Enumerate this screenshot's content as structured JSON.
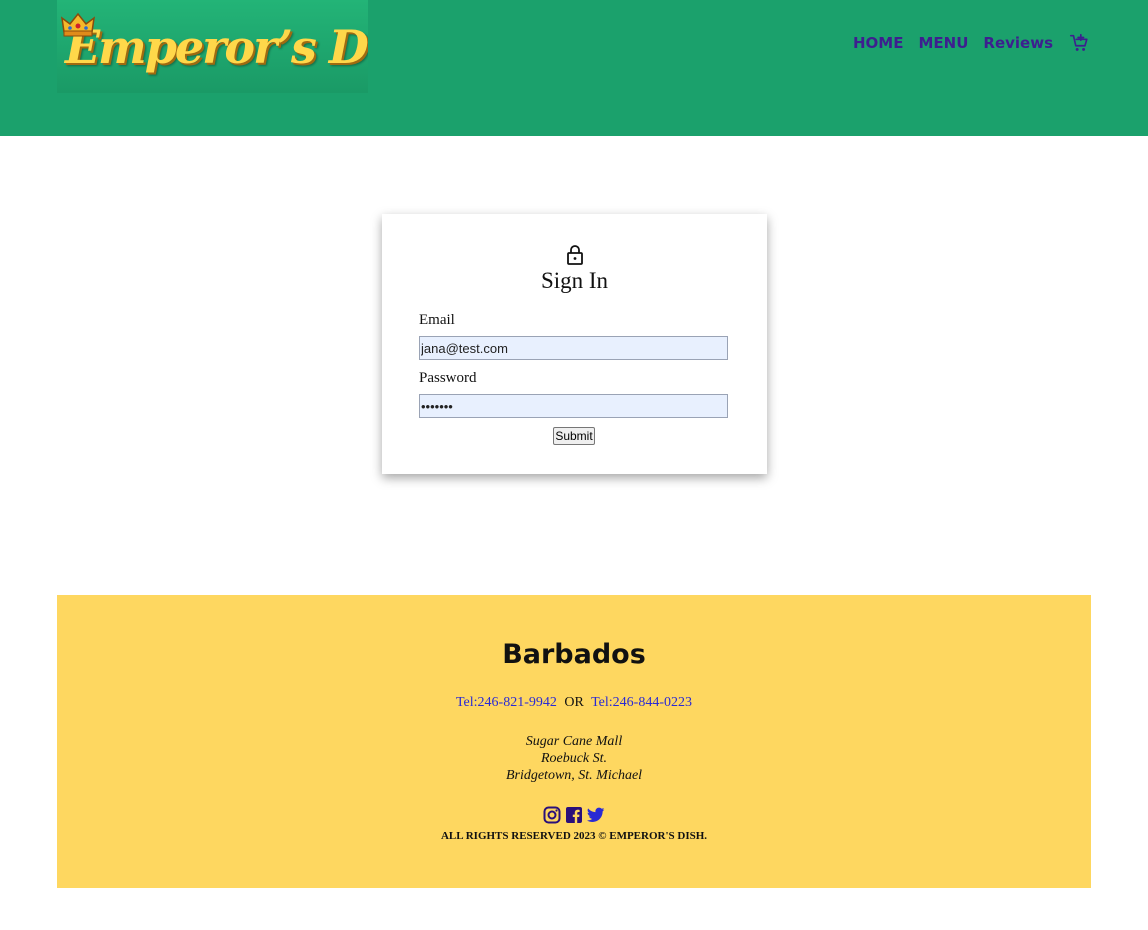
{
  "brand": {
    "logo_text": "Emperor’s Dish"
  },
  "nav": {
    "items": [
      {
        "label": "HOME"
      },
      {
        "label": "MENU"
      },
      {
        "label": "Reviews"
      }
    ],
    "cart_icon": "cart-plus-icon"
  },
  "signin": {
    "lock_icon": "lock-icon",
    "title": "Sign In",
    "email_label": "Email",
    "email_value": "jana@test.com",
    "password_label": "Password",
    "password_value": "1234567",
    "submit_label": "Submit"
  },
  "footer": {
    "title": "Barbados",
    "phone_1": "Tel:246-821-9942",
    "or_text": "OR",
    "phone_2": "Tel:246-844-0223",
    "address_lines": [
      "Sugar Cane Mall",
      "Roebuck St.",
      "Bridgetown, St. Michael"
    ],
    "socials": [
      "instagram-icon",
      "facebook-icon",
      "twitter-icon"
    ],
    "copyright": "ALL RIGHTS RESERVED 2023 © EMPEROR'S DISH."
  },
  "colors": {
    "header_bg": "#1ba16c",
    "nav_text": "#3d1f8f",
    "footer_bg": "#fed760",
    "logo_text": "#ffd84a",
    "link": "#2a2ad4"
  }
}
